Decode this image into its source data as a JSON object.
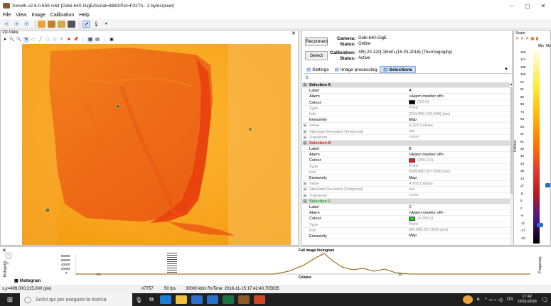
{
  "window": {
    "title": "Xeneth v2.6.0.659 /x64 [Gobi-640-GigE/Serial=8882/Pid=F027h - 2 bytes/pixel]",
    "minimize": "–",
    "maximize": "▢",
    "close": "✕"
  },
  "menu": [
    "File",
    "View",
    "Image",
    "Calibration",
    "Help"
  ],
  "view2d": {
    "title": "2D-View",
    "close": "✕"
  },
  "camera": {
    "reconnect_label": "Reconnect",
    "camera_label": "Camera:",
    "camera_value": "Gobi-640-GigE",
    "status_label": "Status:",
    "status_value": "Online",
    "select_label": "Select",
    "calibration_label": "Calibration:",
    "calibration_value": "XR[-20-120]-18mm-(15-03-2018) (Thermography)",
    "cal_status_label": "Status:",
    "cal_status_value": "Active"
  },
  "tabs": [
    {
      "label": "Settings"
    },
    {
      "label": "Image processing"
    },
    {
      "label": "Selections"
    }
  ],
  "selections": [
    {
      "header": "Selection A",
      "label": "A",
      "alarm": "<Alarm monitor off>",
      "colour": "(0,0,0)",
      "colour_hex": "#000000",
      "type": "Point",
      "info": "(234,000;153,000) (pix)",
      "emissivity": "Map",
      "value": "5.222 Celsius",
      "stddev": "n/a",
      "transform": "<n/a>"
    },
    {
      "header": "Selection B",
      "label": "B",
      "alarm": "<Alarm monitor off>",
      "colour": "(255,0,0)",
      "colour_hex": "#e02020",
      "type": "Point",
      "info": "(548,000;207,000) (pix)",
      "emissivity": "Map",
      "value": "4.765 Celsius",
      "stddev": "n/a",
      "transform": "<n/a>"
    },
    {
      "header": "Selection C",
      "label": "C",
      "alarm": "<Alarm monitor off>",
      "colour": "(0,255,0)",
      "colour_hex": "#22cc22",
      "type": "Point",
      "info": "(86,000;357,000) (pix)",
      "emissivity": "Map"
    }
  ],
  "rowlabels": {
    "label": "Label",
    "alarm": "Alarm",
    "colour": "Colour",
    "type": "Type",
    "info": "Info",
    "emissivity": "Emissivity",
    "value": "Value",
    "stddev": "Standard Deviation (Temporal)",
    "transform": "Transform"
  },
  "scale": {
    "title": "Scale",
    "min": "Min",
    "max": "Mx",
    "axis": "Celsius",
    "ticks": [
      "120",
      "114",
      "108",
      "102",
      "97",
      "91",
      "85",
      "80",
      "74",
      "68",
      "63",
      "57",
      "51",
      "45",
      "40",
      "34",
      "28",
      "23",
      "17",
      "11",
      "5",
      "0",
      "-6",
      "-11",
      "-17",
      "-23"
    ]
  },
  "histogram": {
    "tab_label": "Histogram",
    "title": "Full image histogram",
    "xlabel": "Celsius",
    "ylabel": "Frequency",
    "yticks": [
      "80000",
      "60000",
      "40000",
      "20000",
      "0"
    ],
    "xticks": [
      "-20",
      "15"
    ]
  },
  "status": {
    "coords": "x,y=499,000;215,000 (pix)",
    "frame": "#7757",
    "fps": "50 fps",
    "rx": "30000 kb/s  RxTime: 2018-11-15 17:42:40,705635"
  },
  "taskbar": {
    "search_placeholder": "Scrivi qui per eseguire la ricerca",
    "lang": "ITA",
    "time": "17:42",
    "date": "15/11/2018"
  },
  "colors": {
    "thermal_bg": "#f5a623",
    "accent": "#cde0f7"
  }
}
